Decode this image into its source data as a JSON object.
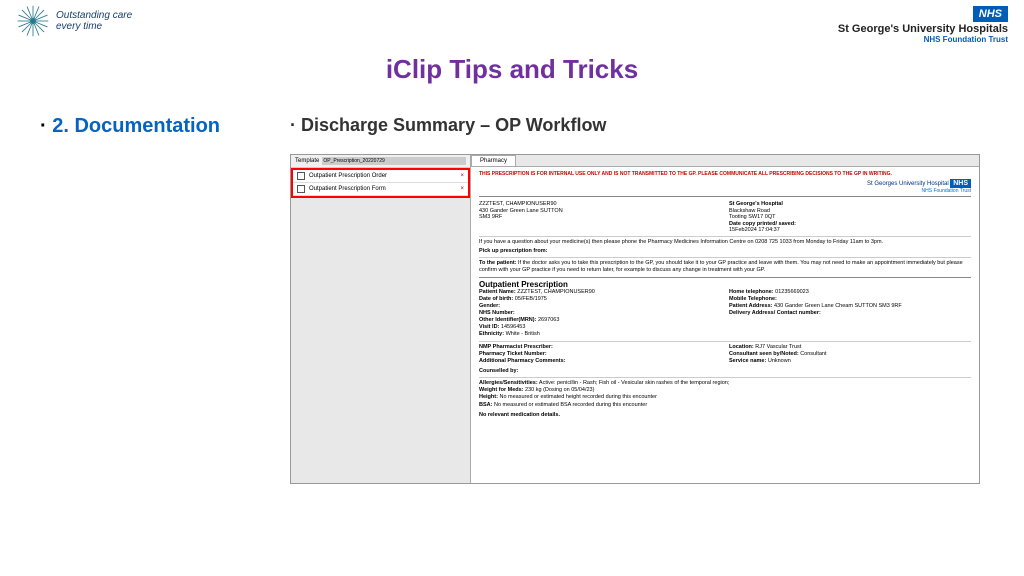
{
  "header": {
    "tagline_l1": "Outstanding care",
    "tagline_l2": "every time",
    "nhs": "NHS",
    "trust": "St George's University Hospitals",
    "trust_sub": "NHS Foundation Trust"
  },
  "title": "iClip Tips and Tricks",
  "section": "2. Documentation",
  "subtitle": "Discharge Summary – OP Workflow",
  "template": {
    "label": "Template",
    "value": "OP_Prescription_20220729",
    "row1": "Outpatient Prescription Order",
    "row2": "Outpatient Prescription Form"
  },
  "doc": {
    "tab": "Pharmacy",
    "warning": "THIS PRESCRIPTION IS FOR INTERNAL USE ONLY AND IS NOT TRANSMITTED TO THE GP. PLEASE COMMUNICATE ALL PRESCRIBING DECISIONS TO THE GP IN WRITING.",
    "hospital": "St Georges University Hospital",
    "hospital_sub": "NHS Foundation Trust",
    "patient_block": {
      "name": "ZZZTEST, CHAMPIONUSER90",
      "addr": "430 Gander Green Lane SUTTON",
      "post": "SM3 9RF"
    },
    "hosp_block": {
      "l1": "St George's Hospital",
      "l2": "Blackshaw Road",
      "l3": "Tooting SW17 0QT",
      "l4_lbl": "Date copy printed/ saved:",
      "l4_val": "15Feb2024 17:04:37"
    },
    "question": "If you have a question about your medicine(s) then please phone the Pharmacy Medicines Information Centre on 0208 725 1033 from Monday to Friday 11am to 3pm.",
    "pickup": "Pick up prescription from:",
    "to_patient_lbl": "To the patient:",
    "to_patient": " If the doctor asks you to take this prescription to the GP, you should take it to your GP practice and leave with them. You may not need to make an appointment immediately but please confirm with your GP practice if you need to return later, for example to discuss any change in treatment with your GP.",
    "sec_title": "Outpatient Prescription",
    "left": {
      "pn_lbl": "Patient Name:",
      "pn": " ZZZTEST, CHAMPIONUSER90",
      "dob_lbl": "Date of birth:",
      "dob": " 05/FEB/1975",
      "gender_lbl": "Gender:",
      "nhs_lbl": "NHS Number:",
      "mrn_lbl": "Other Identifier(MRN):",
      "mrn": " 2697063",
      "visit_lbl": "Visit ID:",
      "visit": " 14596453",
      "eth_lbl": "Ethnicity:",
      "eth": " White - British"
    },
    "right": {
      "tel_lbl": "Home telephone:",
      "tel": " 01235669023",
      "mob_lbl": "Mobile Telephone:",
      "addr_lbl": "Patient Address:",
      "addr": " 430 Gander Green Lane Cheam SUTTON SM3 9RF",
      "del_lbl": "Delivery Address/ Contact number:"
    },
    "mid_left": {
      "nmp_lbl": "NMP Pharmacist Prescriber:",
      "ticket_lbl": "Pharmacy Ticket Number:",
      "comm_lbl": "Additional Pharmacy Comments:",
      "couns_lbl": "Counselled by:"
    },
    "mid_right": {
      "loc_lbl": "Location:",
      "loc": " RJ7 Vascular Trust",
      "cons_lbl": "Consultant seen by/Noted:",
      "cons": " Consultant",
      "svc_lbl": "Service name:",
      "svc": " Unknown"
    },
    "allergies_lbl": "Allergies/Sensitivities:",
    "allergies": "    Active: penicillin - Rash; Fish oil - Vesicular skin rashes of the temporal region;",
    "weight_lbl": "Weight for Meds:",
    "weight": " 230 kg (Dosing on 05/04/23)",
    "height_lbl": "Height:",
    "height": " No measured or estimated height recorded during this encounter",
    "bsa_lbl": "BSA:",
    "bsa": " No measured or estimated BSA recorded during this encounter",
    "no_meds": "No relevant medication details."
  }
}
